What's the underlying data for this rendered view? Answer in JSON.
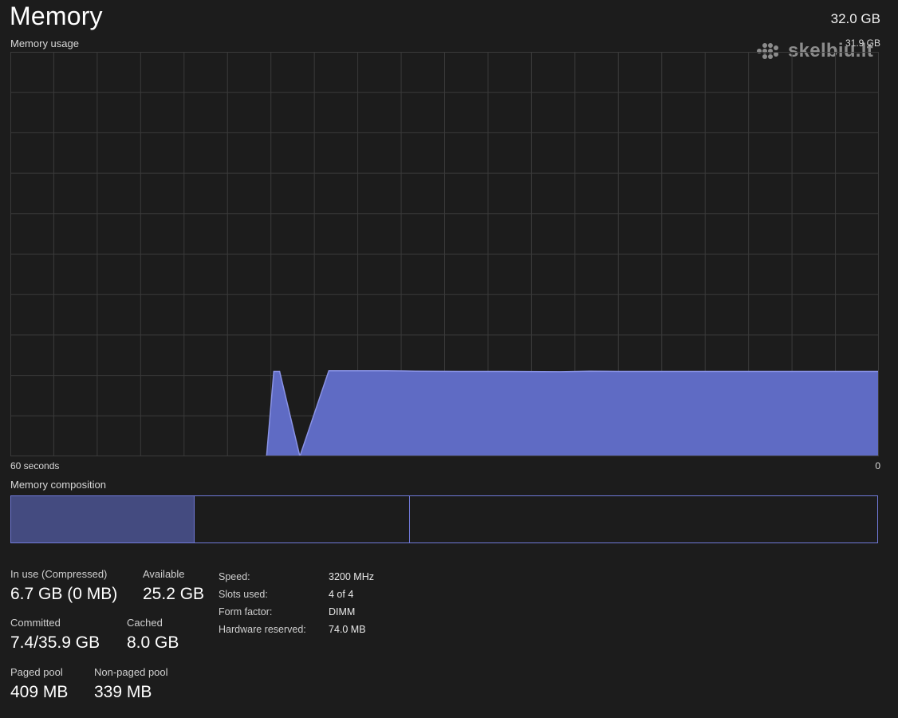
{
  "header": {
    "title": "Memory",
    "total_memory": "32.0 GB",
    "usage_label": "Memory usage",
    "graph_max": "31.9 GB"
  },
  "watermark": {
    "text": "skelbiu.lt"
  },
  "graph": {
    "axis_left": "60 seconds",
    "axis_right": "0",
    "fill_color": "#5f6bc4",
    "line_color": "#8a93e6",
    "grid_color": "#3a3a3a"
  },
  "chart_data": {
    "type": "area",
    "title": "Memory usage",
    "xlabel": "",
    "ylabel": "",
    "x_range": [
      60,
      0
    ],
    "ylim": [
      0,
      31.9
    ],
    "grid": true,
    "x": [
      60,
      56,
      52,
      48,
      44,
      40,
      42.3,
      41.8,
      41.4,
      38,
      36,
      34,
      32,
      29,
      26,
      22,
      20,
      18,
      15,
      12,
      8,
      4,
      0
    ],
    "series": [
      {
        "values": [
          0,
          0,
          0,
          0,
          0,
          0,
          0,
          6.7,
          6.7,
          6.75,
          6.75,
          6.75,
          6.72,
          6.7,
          6.7,
          6.68,
          6.72,
          6.7,
          6.7,
          6.7,
          6.7,
          6.7,
          6.7
        ]
      }
    ]
  },
  "composition": {
    "label": "Memory composition",
    "in_use_fraction": 0.211,
    "modified_fraction": 0.248
  },
  "stats": {
    "in_use": {
      "label": "In use (Compressed)",
      "value": "6.7 GB (0 MB)"
    },
    "available": {
      "label": "Available",
      "value": "25.2 GB"
    },
    "committed": {
      "label": "Committed",
      "value": "7.4/35.9 GB"
    },
    "cached": {
      "label": "Cached",
      "value": "8.0 GB"
    },
    "paged_pool": {
      "label": "Paged pool",
      "value": "409 MB"
    },
    "non_paged_pool": {
      "label": "Non-paged pool",
      "value": "339 MB"
    }
  },
  "details": {
    "speed": {
      "label": "Speed:",
      "value": "3200 MHz"
    },
    "slots_used": {
      "label": "Slots used:",
      "value": "4 of 4"
    },
    "form_factor": {
      "label": "Form factor:",
      "value": "DIMM"
    },
    "hardware_reserved": {
      "label": "Hardware reserved:",
      "value": "74.0 MB"
    }
  }
}
